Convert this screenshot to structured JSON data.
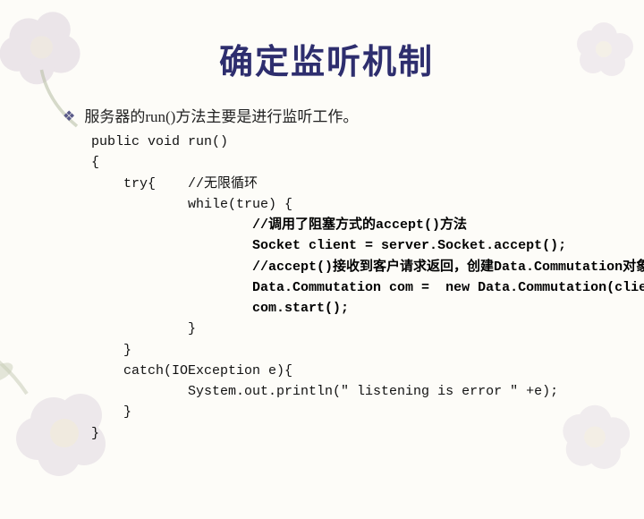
{
  "slide": {
    "title": "确定监听机制",
    "bullet_marker": "❖",
    "bullet": "服务器的run()方法主要是进行监听工作。",
    "code": {
      "l1": "public void run()",
      "l2": "{",
      "l3": "    try{    //无限循环",
      "l4": "            while(true) {",
      "l5": "                    //调用了阻塞方式的accept()方法",
      "l6": "                    Socket client = server.Socket.accept();",
      "l7": "                    //accept()接收到客户请求返回，创建Data.Commutation对象",
      "l8": "                    Data.Commutation com =  new Data.Commutation(client);",
      "l9": "                    com.start();",
      "l10": "            }",
      "l11": "    }",
      "l12": "    catch(IOException e){",
      "l13": "            System.out.println(\" listening is error \" +e);",
      "l14": "    }",
      "l15": "}"
    }
  }
}
